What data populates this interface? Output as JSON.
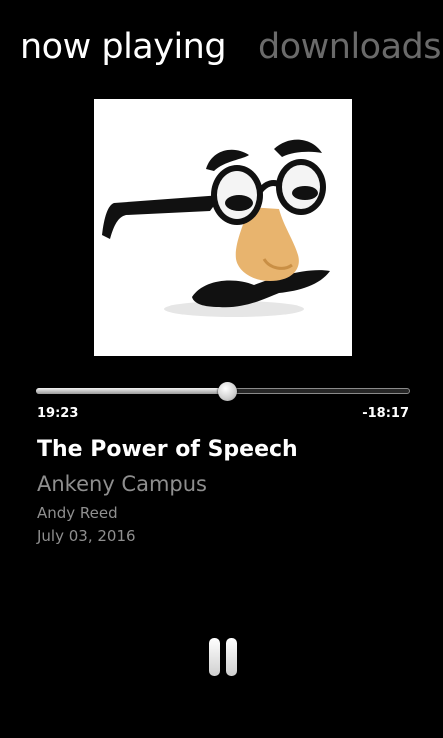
{
  "pivot": {
    "active_label": "now playing",
    "inactive_label": "downloads"
  },
  "album_art": {
    "icon": "groucho-glasses-disguise"
  },
  "player": {
    "progress_fraction": 0.51,
    "elapsed": "19:23",
    "remaining": "-18:17",
    "title": "The Power of Speech",
    "subtitle": "Ankeny Campus",
    "speaker": "Andy Reed",
    "date": "July 03, 2016"
  },
  "controls": {
    "pause_icon": "pause-icon"
  },
  "colors": {
    "background": "#000000",
    "text": "#ffffff",
    "secondary_text": "#8f8f8f",
    "inactive_pivot": "#6a6a6a"
  }
}
